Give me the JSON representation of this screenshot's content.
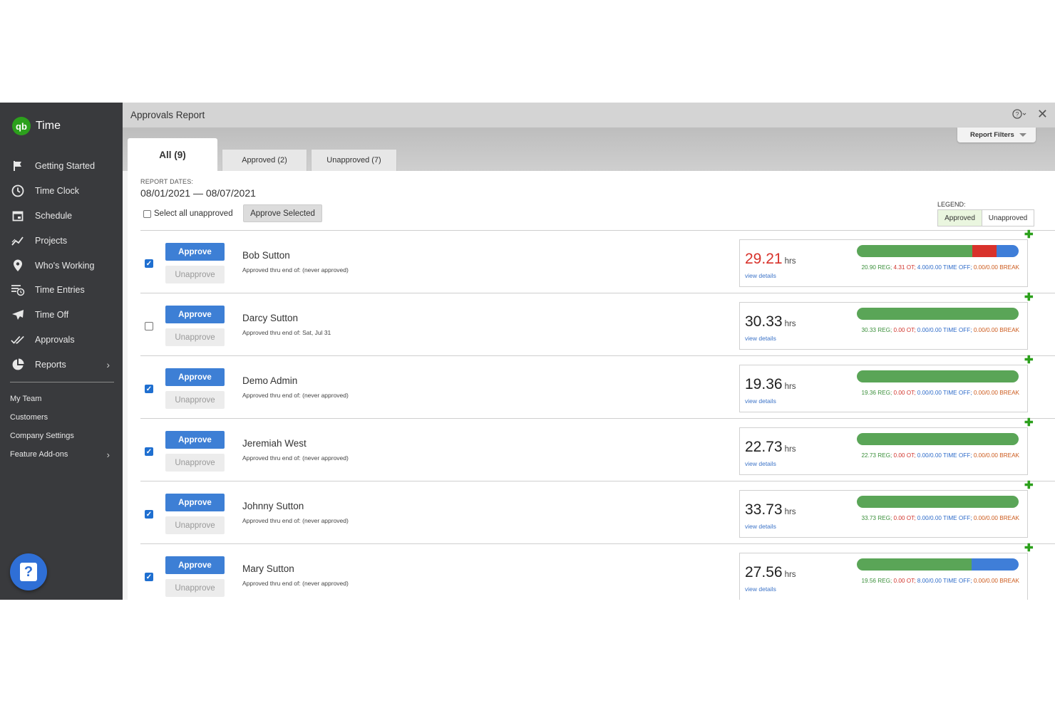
{
  "app": {
    "logo_text": "qb",
    "name": "Time"
  },
  "sidebar": {
    "items": [
      {
        "label": "Getting Started",
        "icon": "flag-icon"
      },
      {
        "label": "Time Clock",
        "icon": "clock-icon"
      },
      {
        "label": "Schedule",
        "icon": "calendar-icon"
      },
      {
        "label": "Projects",
        "icon": "trend-icon"
      },
      {
        "label": "Who's Working",
        "icon": "location-pin-icon"
      },
      {
        "label": "Time Entries",
        "icon": "list-clock-icon"
      },
      {
        "label": "Time Off",
        "icon": "plane-icon"
      },
      {
        "label": "Approvals",
        "icon": "double-check-icon"
      },
      {
        "label": "Reports",
        "icon": "pie-chart-icon",
        "chevron": "›"
      }
    ],
    "sub_items": [
      {
        "label": "My Team"
      },
      {
        "label": "Customers"
      },
      {
        "label": "Company Settings"
      },
      {
        "label": "Feature Add-ons",
        "chevron": "›"
      }
    ],
    "help_glyph": "?"
  },
  "header": {
    "title": "Approvals Report",
    "help_glyph": "?",
    "close_glyph": "✕"
  },
  "filters": {
    "label": "Report Filters"
  },
  "tabs": [
    {
      "label": "All (9)"
    },
    {
      "label": "Approved (2)"
    },
    {
      "label": "Unapproved (7)"
    }
  ],
  "report": {
    "dates_label": "REPORT DATES:",
    "date_range": "08/01/2021 — 08/07/2021",
    "select_all_label": "Select all unapproved",
    "approve_selected_label": "Approve Selected",
    "legend_label": "LEGEND:",
    "legend_approved": "Approved",
    "legend_unapproved": "Unapproved"
  },
  "labels": {
    "approve": "Approve",
    "unapprove": "Unapprove",
    "hrs": "hrs",
    "view_details": "view details",
    "plus": "✚"
  },
  "colors": {
    "reg": "#5aa557",
    "ot": "#d8322b",
    "time_off": "#3f7ed8",
    "break": "#cc5a1c"
  },
  "employees": [
    {
      "name": "Bob Sutton",
      "approved_thru": "Approved thru end of: (never approved)",
      "checked": true,
      "hours": "29.21",
      "hours_red": true,
      "reg": "20.90 REG;",
      "ot": "4.31 OT;",
      "time_off": "4.00/0.00 TIME OFF;",
      "break": "0.00/0.00 BREAK",
      "bar": {
        "reg": 20.9,
        "ot": 4.31,
        "time_off": 4.0
      }
    },
    {
      "name": "Darcy Sutton",
      "approved_thru": "Approved thru end of: Sat, Jul 31",
      "checked": false,
      "hours": "30.33",
      "hours_red": false,
      "reg": "30.33 REG;",
      "ot": "0.00 OT;",
      "time_off": "0.00/0.00 TIME OFF;",
      "break": "0.00/0.00 BREAK",
      "bar": {
        "reg": 30.33,
        "ot": 0,
        "time_off": 0
      }
    },
    {
      "name": "Demo Admin",
      "approved_thru": "Approved thru end of: (never approved)",
      "checked": true,
      "hours": "19.36",
      "hours_red": false,
      "reg": "19.36 REG;",
      "ot": "0.00 OT;",
      "time_off": "0.00/0.00 TIME OFF;",
      "break": "0.00/0.00 BREAK",
      "bar": {
        "reg": 19.36,
        "ot": 0,
        "time_off": 0
      }
    },
    {
      "name": "Jeremiah West",
      "approved_thru": "Approved thru end of: (never approved)",
      "checked": true,
      "hours": "22.73",
      "hours_red": false,
      "reg": "22.73 REG;",
      "ot": "0.00 OT;",
      "time_off": "0.00/0.00 TIME OFF;",
      "break": "0.00/0.00 BREAK",
      "bar": {
        "reg": 22.73,
        "ot": 0,
        "time_off": 0
      }
    },
    {
      "name": "Johnny Sutton",
      "approved_thru": "Approved thru end of: (never approved)",
      "checked": true,
      "hours": "33.73",
      "hours_red": false,
      "reg": "33.73 REG;",
      "ot": "0.00 OT;",
      "time_off": "0.00/0.00 TIME OFF;",
      "break": "0.00/0.00 BREAK",
      "bar": {
        "reg": 33.73,
        "ot": 0,
        "time_off": 0
      }
    },
    {
      "name": "Mary Sutton",
      "approved_thru": "Approved thru end of: (never approved)",
      "checked": true,
      "hours": "27.56",
      "hours_red": false,
      "reg": "19.56 REG;",
      "ot": "0.00 OT;",
      "time_off": "8.00/0.00 TIME OFF;",
      "break": "0.00/0.00 BREAK",
      "bar": {
        "reg": 19.56,
        "ot": 0,
        "time_off": 8.0
      }
    }
  ]
}
